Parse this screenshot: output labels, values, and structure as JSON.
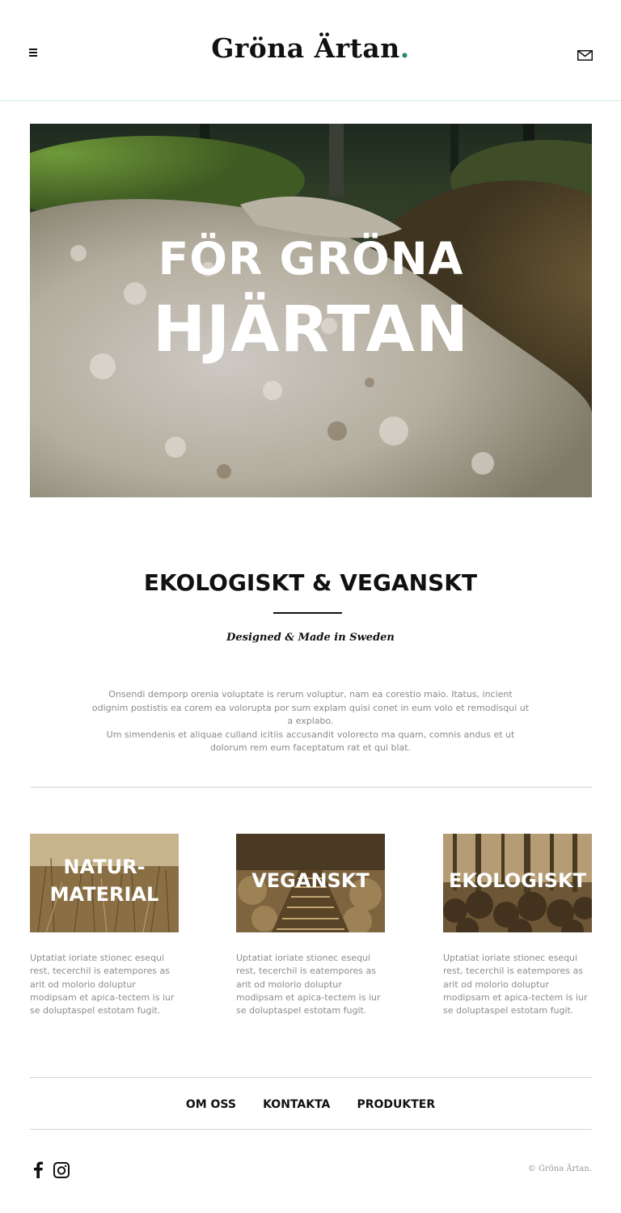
{
  "header": {
    "logo_text": "Gröna Ärtan",
    "logo_dot": ".",
    "brand_accent": "#2e8a62"
  },
  "hero": {
    "line1": "FÖR GRÖNA",
    "line2": "HJÄRTAN"
  },
  "intro": {
    "title": "EKOLOGISKT & VEGANSKT",
    "subtitle": "Designed & Made in Sweden",
    "body_line1": "Onsendi demporp orenia voluptate is rerum voluptur, nam ea corestio maio. Itatus, incient odignim postistis ea corem ea volorupta por sum explam quisi conet in eum volo et remodisqui ut a explabo.",
    "body_line2": "Um simendenis et aliquae culland icitiis accusandit volorecto ma quam, comnis andus et ut dolorum rem eum faceptatum rat et qui blat."
  },
  "cards": [
    {
      "title_line1": "NATUR-",
      "title_line2": "MATERIAL",
      "text": "Uptatiat ioriate stionec esequi rest, tecerchil is eatempores as arit od molorio doluptur modipsam et apica-tectem is iur se doluptaspel estotam fugit."
    },
    {
      "title_line1": "VEGANSKT",
      "text": "Uptatiat ioriate stionec esequi rest, tecerchil is eatempores as arit od molorio doluptur modipsam et apica-tectem is iur se doluptaspel estotam fugit."
    },
    {
      "title_line1": "EKOLOGISKT",
      "text": "Uptatiat ioriate stionec esequi rest, tecerchil is eatempores as arit od molorio doluptur modipsam et apica-tectem is iur se doluptaspel estotam fugit."
    }
  ],
  "footer": {
    "nav": [
      "OM OSS",
      "KONTAKTA",
      "PRODUKTER"
    ],
    "copyright": "© Gröna Ärtan.",
    "social_icons": [
      "facebook-icon",
      "instagram-icon"
    ]
  }
}
